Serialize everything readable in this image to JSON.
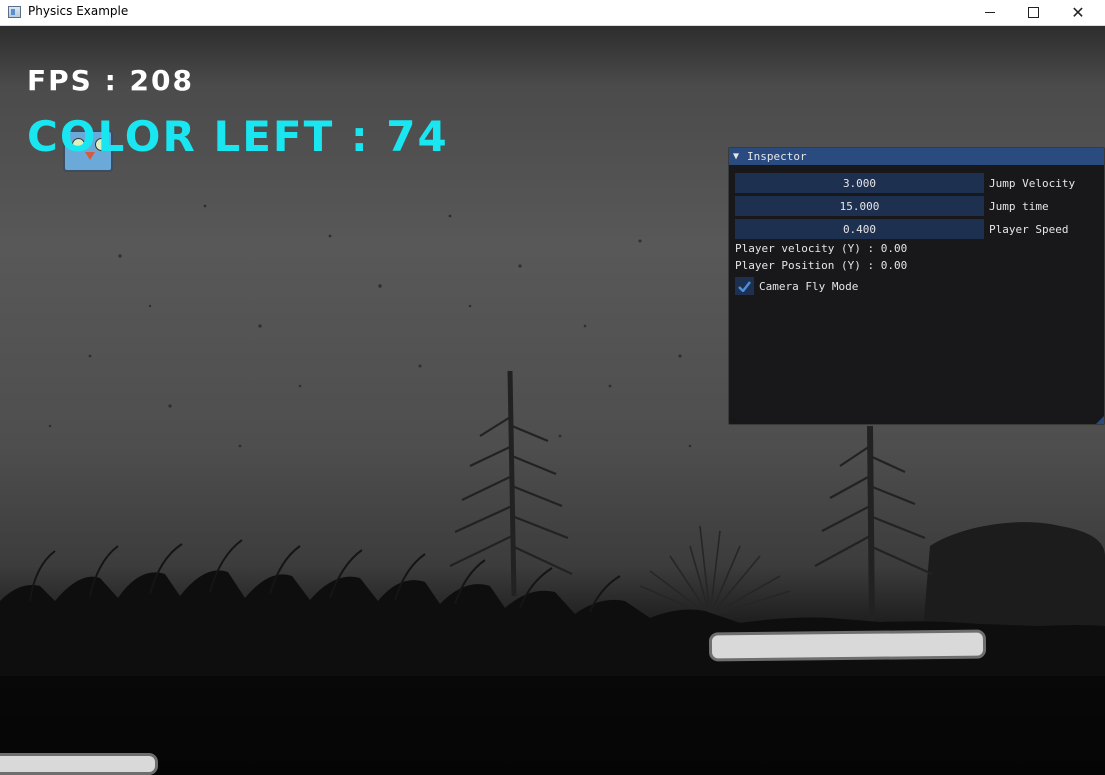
{
  "window": {
    "title": "Physics Example"
  },
  "hud": {
    "fps_text": "FPS : 208",
    "color_left_text": "COLOR LEFT : 74"
  },
  "inspector": {
    "title": "Inspector",
    "fields": [
      {
        "value": "3.000",
        "label": "Jump Velocity"
      },
      {
        "value": "15.000",
        "label": "Jump time"
      },
      {
        "value": "0.400",
        "label": "Player Speed"
      }
    ],
    "velocity_text": "Player velocity (Y) : 0.00",
    "position_text": "Player Position (Y) : 0.00",
    "camera_fly_label": "Camera Fly Mode",
    "camera_fly_checked": true
  },
  "colors": {
    "hud_fps": "#ffffff",
    "hud_color_left": "#19e6f0",
    "inspector_header": "#2a4b80",
    "inspector_field": "#1d3050",
    "checkmark": "#4a90e2",
    "platform": "#d9d9d9"
  }
}
